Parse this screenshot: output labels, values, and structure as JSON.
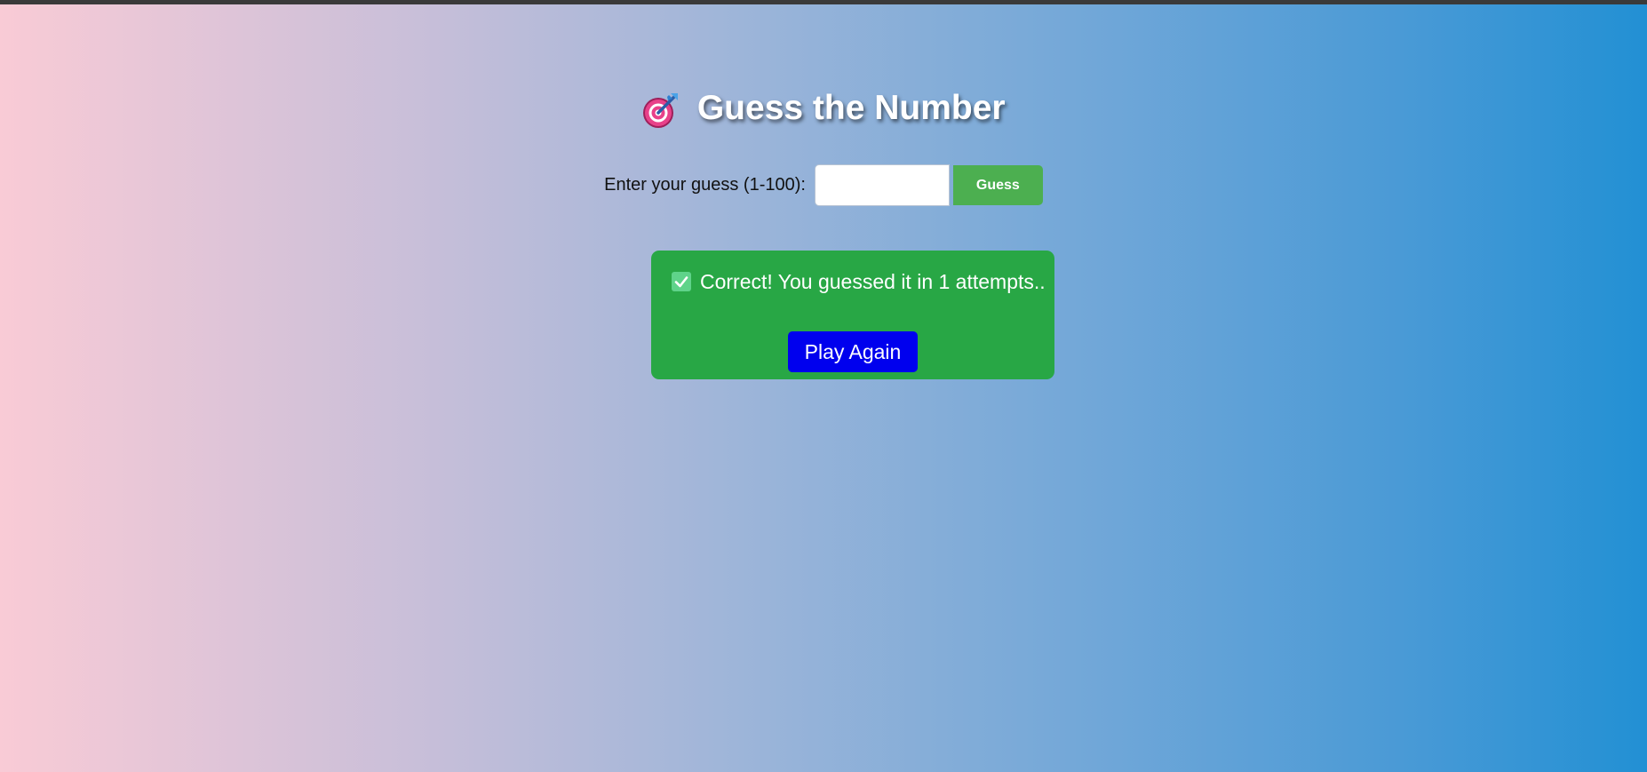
{
  "header": {
    "icon": "target-icon",
    "title": "Guess the Number"
  },
  "guess_form": {
    "label": "Enter your guess (1-100):",
    "input_value": "",
    "input_placeholder": "",
    "button_label": "Guess"
  },
  "result": {
    "icon": "check-icon",
    "message": "Correct! You guessed it in 1 attempts..",
    "play_again_label": "Play Again"
  },
  "colors": {
    "guess_button": "#4caf50",
    "result_box": "#28a745",
    "play_again_button": "#0000ee",
    "gradient_start": "#f9cbd6",
    "gradient_end": "#2290d4"
  }
}
